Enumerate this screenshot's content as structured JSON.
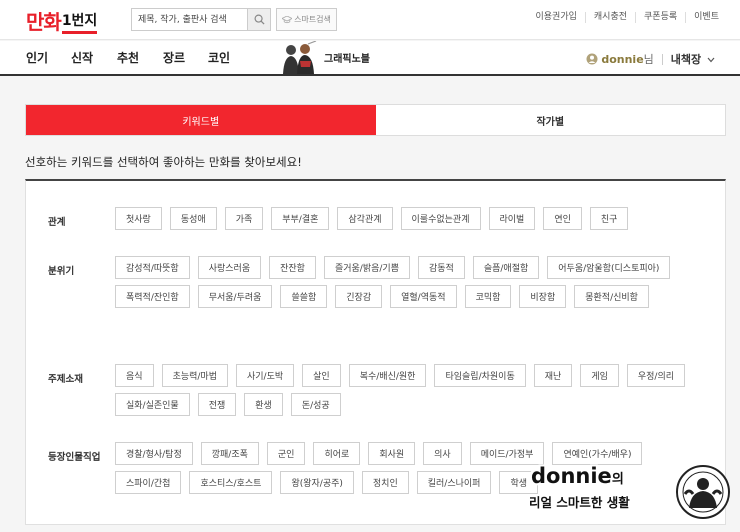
{
  "header": {
    "logo_part1": "만화",
    "logo_part2": "1번지",
    "search_placeholder": "제목, 작가, 출판사 검색",
    "smart_search_label": "스마트검색",
    "links": [
      "이용권가입",
      "캐시충전",
      "쿠폰등록",
      "이벤트"
    ]
  },
  "nav": {
    "items": [
      "인기",
      "신작",
      "추천",
      "장르",
      "코인"
    ],
    "graphic_novel_label": "그래픽노블",
    "username": "donnie",
    "honorific": "님",
    "bookshelf_label": "내책장"
  },
  "tabs": [
    {
      "label": "키워드별",
      "active": true
    },
    {
      "label": "작가별",
      "active": false
    }
  ],
  "intro_text": "선호하는 키워드를 선택하여 좋아하는 만화를 찾아보세요!",
  "categories": [
    {
      "label": "관계",
      "tags": [
        "첫사랑",
        "동성애",
        "가족",
        "부부/결혼",
        "삼각관계",
        "이룰수없는관계",
        "라이벌",
        "연인",
        "친구"
      ]
    },
    {
      "label": "분위기",
      "tags": [
        "감성적/따뜻함",
        "사랑스러움",
        "잔잔함",
        "즐거움/밝음/기쁨",
        "감동적",
        "슬픔/애절함",
        "어두움/암울함(디스토피아)",
        "폭력적/잔인함",
        "무서움/두려움",
        "쓸쓸함",
        "긴장감",
        "열혈/역동적",
        "코믹함",
        "비장함",
        "몽환적/신비함"
      ]
    },
    {
      "label": "주제소재",
      "tags": [
        "음식",
        "초능력/마법",
        "사기/도박",
        "살인",
        "복수/배신/원한",
        "타임슬립/차원이동",
        "재난",
        "게임",
        "우정/의리",
        "실화/실존인물",
        "전쟁",
        "환생",
        "돈/성공"
      ]
    },
    {
      "label": "등장인물직업",
      "tags": [
        "경찰/형사/탐정",
        "깡패/조폭",
        "군인",
        "히어로",
        "회사원",
        "의사",
        "메이드/가정부",
        "연예인(가수/배우)",
        "스파이/간첩",
        "호스티스/호스트",
        "왕(왕자/공주)",
        "정치인",
        "킬러/스나이퍼",
        "학생"
      ]
    }
  ],
  "watermark": {
    "title": "donnie",
    "title_suffix": "의",
    "subtitle": "리얼 스마트한 생활"
  },
  "colors": {
    "accent": "#f2262e",
    "logo_red": "#e8202a"
  }
}
